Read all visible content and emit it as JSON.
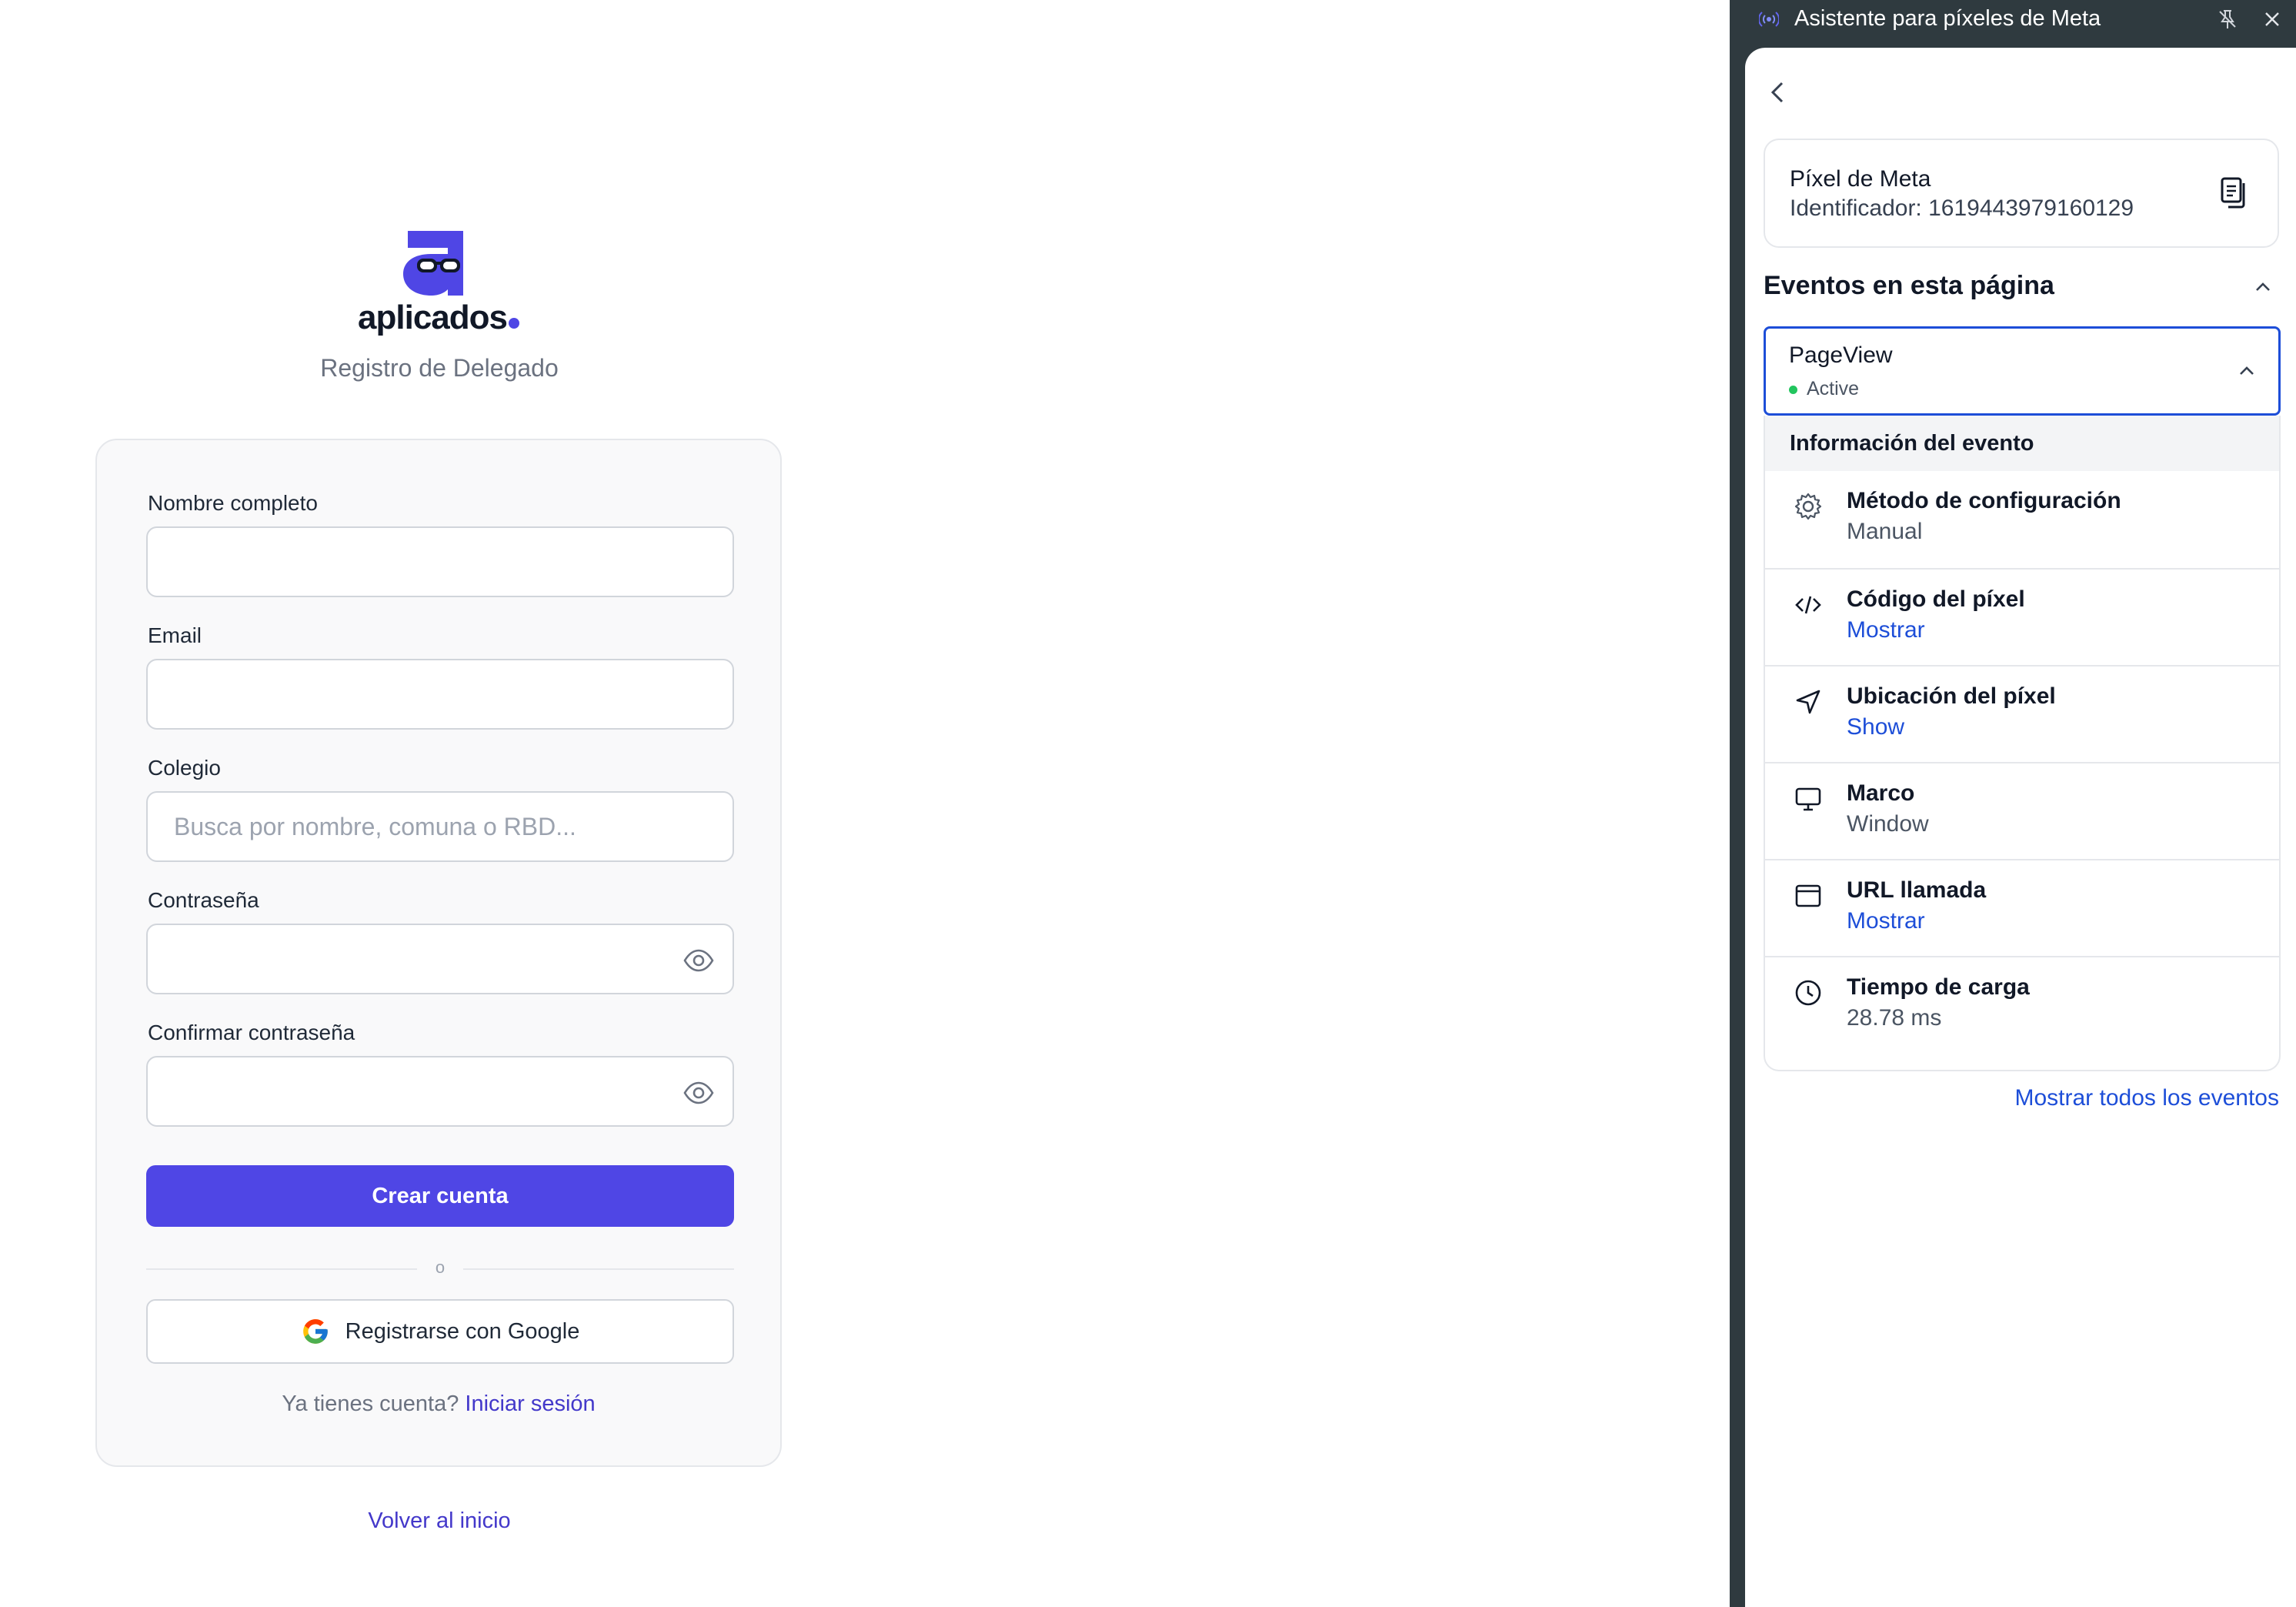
{
  "app": {
    "brand": "aplicados",
    "subtitle": "Registro de Delegado"
  },
  "form": {
    "fields": [
      {
        "label": "Nombre completo",
        "value": "",
        "placeholder": ""
      },
      {
        "label": "Email",
        "value": "",
        "placeholder": ""
      },
      {
        "label": "Colegio",
        "value": "",
        "placeholder": "Busca por nombre, comuna o RBD..."
      },
      {
        "label": "Contraseña",
        "value": "",
        "placeholder": ""
      },
      {
        "label": "Confirmar contraseña",
        "value": "",
        "placeholder": ""
      }
    ],
    "submit_label": "Crear cuenta",
    "divider_label": "o",
    "google_label": "Registrarse con Google",
    "login_prompt": "Ya tienes cuenta?",
    "login_link": "Iniciar sesión",
    "back_link": "Volver al inicio"
  },
  "extension": {
    "title": "Asistente para píxeles de Meta",
    "pixel": {
      "name": "Píxel de Meta",
      "id_text": "Identificador: 1619443979160129"
    },
    "section_title": "Eventos en esta página",
    "event": {
      "name": "PageView",
      "status": "Active"
    },
    "info_header": "Información del evento",
    "info_rows": [
      {
        "icon": "gear-icon",
        "label": "Método de configuración",
        "value": "Manual",
        "is_link": false
      },
      {
        "icon": "code-icon",
        "label": "Código del píxel",
        "value": "Mostrar",
        "is_link": true
      },
      {
        "icon": "location-arrow-icon",
        "label": "Ubicación del píxel",
        "value": "Show",
        "is_link": true
      },
      {
        "icon": "monitor-icon",
        "label": "Marco",
        "value": "Window",
        "is_link": false
      },
      {
        "icon": "browser-window-icon",
        "label": "URL llamada",
        "value": "Mostrar",
        "is_link": true
      },
      {
        "icon": "clock-icon",
        "label": "Tiempo de carga",
        "value": "28.78 ms",
        "is_link": false
      }
    ],
    "show_all_label": "Mostrar todos los eventos"
  },
  "colors": {
    "primary": "#4f46e5",
    "link": "#4338ca",
    "ext_link": "#1d4ed8",
    "ext_frame": "#2f3a3f",
    "active_dot": "#22c55e"
  }
}
